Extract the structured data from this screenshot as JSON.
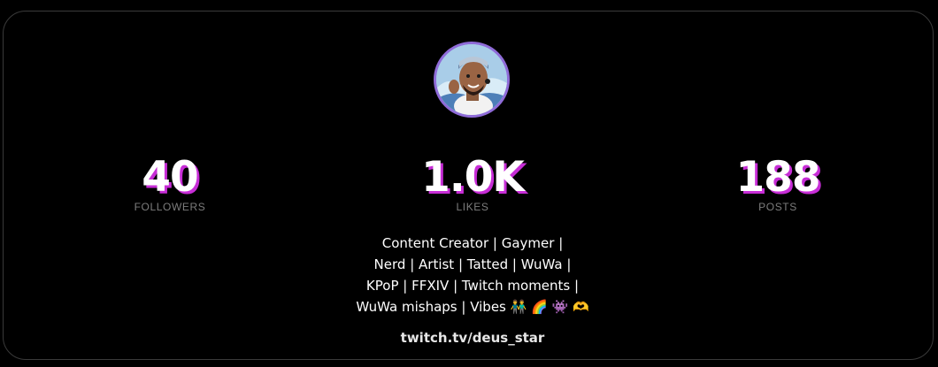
{
  "profile": {
    "avatar_alt": "profile avatar",
    "stats": [
      {
        "value": "40",
        "label": "FOLLOWERS"
      },
      {
        "value": "1.0K",
        "label": "LIKES"
      },
      {
        "value": "188",
        "label": "POSTS"
      }
    ],
    "bio_lines": [
      "Content Creator | Gaymer |",
      "Nerd | Artist | Tatted | WuWa |",
      "KPoP | FFXIV | Twitch moments |",
      "WuWa mishaps | Vibes 👬 🌈 👾 🫶"
    ],
    "link": "twitch.tv/deus_star"
  },
  "colors": {
    "background": "#000000",
    "card_border": "#3a3a3a",
    "stat_shadow": "#c72dd6",
    "label": "#7d7d7d",
    "avatar_ring": "#8f6bd8"
  }
}
